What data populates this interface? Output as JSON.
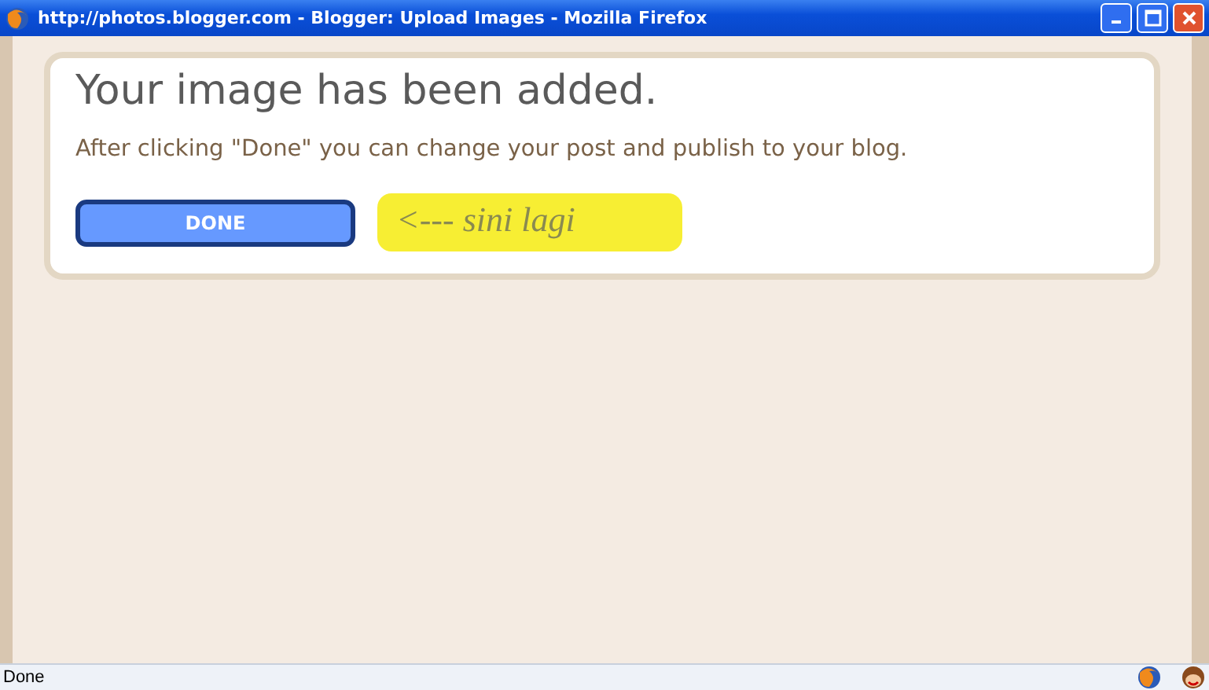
{
  "window": {
    "title": "http://photos.blogger.com - Blogger: Upload Images - Mozilla Firefox"
  },
  "dialog": {
    "heading": "Your image has been added.",
    "message": "After clicking \"Done\" you can change your post and publish to your blog.",
    "button": "DONE",
    "note": "<--- sini lagi"
  },
  "status_bar": {
    "text": "Done"
  }
}
